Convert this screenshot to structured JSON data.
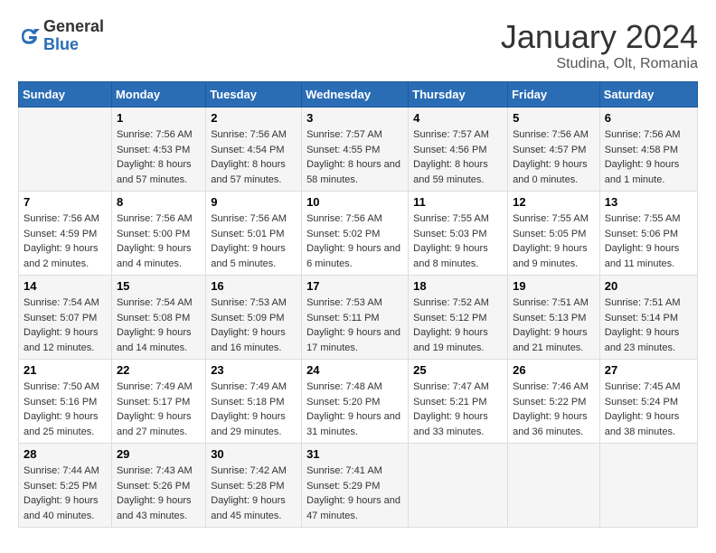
{
  "header": {
    "logo_general": "General",
    "logo_blue": "Blue",
    "month_title": "January 2024",
    "location": "Studina, Olt, Romania"
  },
  "weekdays": [
    "Sunday",
    "Monday",
    "Tuesday",
    "Wednesday",
    "Thursday",
    "Friday",
    "Saturday"
  ],
  "weeks": [
    [
      {
        "day": "",
        "sunrise": "",
        "sunset": "",
        "daylight": ""
      },
      {
        "day": "1",
        "sunrise": "Sunrise: 7:56 AM",
        "sunset": "Sunset: 4:53 PM",
        "daylight": "Daylight: 8 hours and 57 minutes."
      },
      {
        "day": "2",
        "sunrise": "Sunrise: 7:56 AM",
        "sunset": "Sunset: 4:54 PM",
        "daylight": "Daylight: 8 hours and 57 minutes."
      },
      {
        "day": "3",
        "sunrise": "Sunrise: 7:57 AM",
        "sunset": "Sunset: 4:55 PM",
        "daylight": "Daylight: 8 hours and 58 minutes."
      },
      {
        "day": "4",
        "sunrise": "Sunrise: 7:57 AM",
        "sunset": "Sunset: 4:56 PM",
        "daylight": "Daylight: 8 hours and 59 minutes."
      },
      {
        "day": "5",
        "sunrise": "Sunrise: 7:56 AM",
        "sunset": "Sunset: 4:57 PM",
        "daylight": "Daylight: 9 hours and 0 minutes."
      },
      {
        "day": "6",
        "sunrise": "Sunrise: 7:56 AM",
        "sunset": "Sunset: 4:58 PM",
        "daylight": "Daylight: 9 hours and 1 minute."
      }
    ],
    [
      {
        "day": "7",
        "sunrise": "Sunrise: 7:56 AM",
        "sunset": "Sunset: 4:59 PM",
        "daylight": "Daylight: 9 hours and 2 minutes."
      },
      {
        "day": "8",
        "sunrise": "Sunrise: 7:56 AM",
        "sunset": "Sunset: 5:00 PM",
        "daylight": "Daylight: 9 hours and 4 minutes."
      },
      {
        "day": "9",
        "sunrise": "Sunrise: 7:56 AM",
        "sunset": "Sunset: 5:01 PM",
        "daylight": "Daylight: 9 hours and 5 minutes."
      },
      {
        "day": "10",
        "sunrise": "Sunrise: 7:56 AM",
        "sunset": "Sunset: 5:02 PM",
        "daylight": "Daylight: 9 hours and 6 minutes."
      },
      {
        "day": "11",
        "sunrise": "Sunrise: 7:55 AM",
        "sunset": "Sunset: 5:03 PM",
        "daylight": "Daylight: 9 hours and 8 minutes."
      },
      {
        "day": "12",
        "sunrise": "Sunrise: 7:55 AM",
        "sunset": "Sunset: 5:05 PM",
        "daylight": "Daylight: 9 hours and 9 minutes."
      },
      {
        "day": "13",
        "sunrise": "Sunrise: 7:55 AM",
        "sunset": "Sunset: 5:06 PM",
        "daylight": "Daylight: 9 hours and 11 minutes."
      }
    ],
    [
      {
        "day": "14",
        "sunrise": "Sunrise: 7:54 AM",
        "sunset": "Sunset: 5:07 PM",
        "daylight": "Daylight: 9 hours and 12 minutes."
      },
      {
        "day": "15",
        "sunrise": "Sunrise: 7:54 AM",
        "sunset": "Sunset: 5:08 PM",
        "daylight": "Daylight: 9 hours and 14 minutes."
      },
      {
        "day": "16",
        "sunrise": "Sunrise: 7:53 AM",
        "sunset": "Sunset: 5:09 PM",
        "daylight": "Daylight: 9 hours and 16 minutes."
      },
      {
        "day": "17",
        "sunrise": "Sunrise: 7:53 AM",
        "sunset": "Sunset: 5:11 PM",
        "daylight": "Daylight: 9 hours and 17 minutes."
      },
      {
        "day": "18",
        "sunrise": "Sunrise: 7:52 AM",
        "sunset": "Sunset: 5:12 PM",
        "daylight": "Daylight: 9 hours and 19 minutes."
      },
      {
        "day": "19",
        "sunrise": "Sunrise: 7:51 AM",
        "sunset": "Sunset: 5:13 PM",
        "daylight": "Daylight: 9 hours and 21 minutes."
      },
      {
        "day": "20",
        "sunrise": "Sunrise: 7:51 AM",
        "sunset": "Sunset: 5:14 PM",
        "daylight": "Daylight: 9 hours and 23 minutes."
      }
    ],
    [
      {
        "day": "21",
        "sunrise": "Sunrise: 7:50 AM",
        "sunset": "Sunset: 5:16 PM",
        "daylight": "Daylight: 9 hours and 25 minutes."
      },
      {
        "day": "22",
        "sunrise": "Sunrise: 7:49 AM",
        "sunset": "Sunset: 5:17 PM",
        "daylight": "Daylight: 9 hours and 27 minutes."
      },
      {
        "day": "23",
        "sunrise": "Sunrise: 7:49 AM",
        "sunset": "Sunset: 5:18 PM",
        "daylight": "Daylight: 9 hours and 29 minutes."
      },
      {
        "day": "24",
        "sunrise": "Sunrise: 7:48 AM",
        "sunset": "Sunset: 5:20 PM",
        "daylight": "Daylight: 9 hours and 31 minutes."
      },
      {
        "day": "25",
        "sunrise": "Sunrise: 7:47 AM",
        "sunset": "Sunset: 5:21 PM",
        "daylight": "Daylight: 9 hours and 33 minutes."
      },
      {
        "day": "26",
        "sunrise": "Sunrise: 7:46 AM",
        "sunset": "Sunset: 5:22 PM",
        "daylight": "Daylight: 9 hours and 36 minutes."
      },
      {
        "day": "27",
        "sunrise": "Sunrise: 7:45 AM",
        "sunset": "Sunset: 5:24 PM",
        "daylight": "Daylight: 9 hours and 38 minutes."
      }
    ],
    [
      {
        "day": "28",
        "sunrise": "Sunrise: 7:44 AM",
        "sunset": "Sunset: 5:25 PM",
        "daylight": "Daylight: 9 hours and 40 minutes."
      },
      {
        "day": "29",
        "sunrise": "Sunrise: 7:43 AM",
        "sunset": "Sunset: 5:26 PM",
        "daylight": "Daylight: 9 hours and 43 minutes."
      },
      {
        "day": "30",
        "sunrise": "Sunrise: 7:42 AM",
        "sunset": "Sunset: 5:28 PM",
        "daylight": "Daylight: 9 hours and 45 minutes."
      },
      {
        "day": "31",
        "sunrise": "Sunrise: 7:41 AM",
        "sunset": "Sunset: 5:29 PM",
        "daylight": "Daylight: 9 hours and 47 minutes."
      },
      {
        "day": "",
        "sunrise": "",
        "sunset": "",
        "daylight": ""
      },
      {
        "day": "",
        "sunrise": "",
        "sunset": "",
        "daylight": ""
      },
      {
        "day": "",
        "sunrise": "",
        "sunset": "",
        "daylight": ""
      }
    ]
  ]
}
